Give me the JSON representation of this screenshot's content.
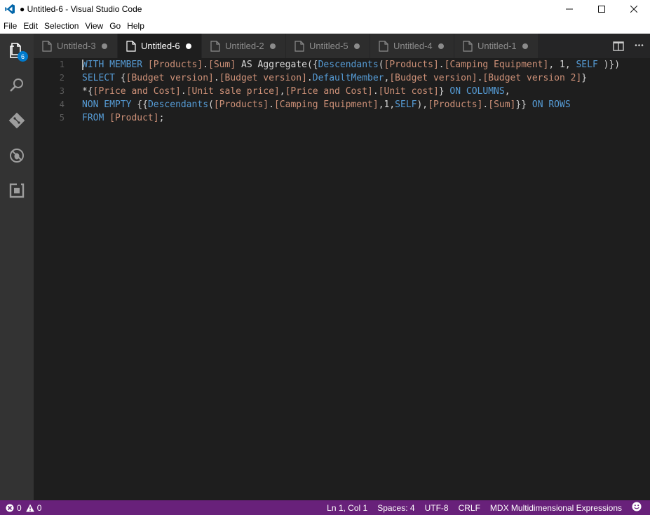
{
  "window": {
    "title": "● Untitled-6 - Visual Studio Code",
    "minimize": "—",
    "maximize": "☐",
    "close": "✕"
  },
  "menu": [
    "File",
    "Edit",
    "Selection",
    "View",
    "Go",
    "Help"
  ],
  "activity": {
    "explorer_badge": "6",
    "icons": [
      "files-icon",
      "search-icon",
      "git-icon",
      "debug-icon",
      "extensions-icon"
    ]
  },
  "tabs": [
    {
      "label": "Untitled-3",
      "active": false
    },
    {
      "label": "Untitled-6",
      "active": true
    },
    {
      "label": "Untitled-2",
      "active": false
    },
    {
      "label": "Untitled-5",
      "active": false
    },
    {
      "label": "Untitled-4",
      "active": false
    },
    {
      "label": "Untitled-1",
      "active": false
    }
  ],
  "tab_actions": {
    "split": "split-editor-icon",
    "more": "•••"
  },
  "editor": {
    "lines": [
      {
        "num": "1",
        "tokens": [
          [
            "kw",
            "WITH MEMBER "
          ],
          [
            "id",
            "[Products]"
          ],
          [
            "pl",
            "."
          ],
          [
            "id",
            "[Sum]"
          ],
          [
            "pl",
            " AS "
          ],
          [
            "fn",
            "Aggregate"
          ],
          [
            "pl",
            "({"
          ],
          [
            "kw",
            "Descendants"
          ],
          [
            "pl",
            "("
          ],
          [
            "id",
            "[Products]"
          ],
          [
            "pl",
            "."
          ],
          [
            "id",
            "[Camping Equipment]"
          ],
          [
            "pl",
            ", 1, "
          ],
          [
            "kw",
            "SELF"
          ],
          [
            "pl",
            " )})"
          ]
        ]
      },
      {
        "num": "2",
        "tokens": [
          [
            "kw",
            "SELECT "
          ],
          [
            "pl",
            "{"
          ],
          [
            "id",
            "[Budget version]"
          ],
          [
            "pl",
            "."
          ],
          [
            "id",
            "[Budget version]"
          ],
          [
            "pl",
            "."
          ],
          [
            "kw",
            "DefaultMember"
          ],
          [
            "pl",
            ","
          ],
          [
            "id",
            "[Budget version]"
          ],
          [
            "pl",
            "."
          ],
          [
            "id",
            "[Budget version 2]"
          ],
          [
            "pl",
            "}"
          ]
        ]
      },
      {
        "num": "3",
        "tokens": [
          [
            "pl",
            "*{"
          ],
          [
            "id",
            "[Price and Cost]"
          ],
          [
            "pl",
            "."
          ],
          [
            "id",
            "[Unit sale price]"
          ],
          [
            "pl",
            ","
          ],
          [
            "id",
            "[Price and Cost]"
          ],
          [
            "pl",
            "."
          ],
          [
            "id",
            "[Unit cost]"
          ],
          [
            "pl",
            "} "
          ],
          [
            "kw",
            "ON COLUMNS"
          ],
          [
            "pl",
            ","
          ]
        ]
      },
      {
        "num": "4",
        "tokens": [
          [
            "kw",
            "NON EMPTY "
          ],
          [
            "pl",
            "{{"
          ],
          [
            "kw",
            "Descendants"
          ],
          [
            "pl",
            "("
          ],
          [
            "id",
            "[Products]"
          ],
          [
            "pl",
            "."
          ],
          [
            "id",
            "[Camping Equipment]"
          ],
          [
            "pl",
            ",1,"
          ],
          [
            "kw",
            "SELF"
          ],
          [
            "pl",
            "),"
          ],
          [
            "id",
            "[Products]"
          ],
          [
            "pl",
            "."
          ],
          [
            "id",
            "[Sum]"
          ],
          [
            "pl",
            "}} "
          ],
          [
            "kw",
            "ON ROWS"
          ]
        ]
      },
      {
        "num": "5",
        "tokens": [
          [
            "kw",
            "FROM "
          ],
          [
            "id",
            "[Product]"
          ],
          [
            "pl",
            ";"
          ]
        ]
      }
    ]
  },
  "status": {
    "errors": "0",
    "warnings": "0",
    "position": "Ln 1, Col 1",
    "indent": "Spaces: 4",
    "encoding": "UTF-8",
    "eol": "CRLF",
    "language": "MDX Multidimensional Expressions"
  },
  "colors": {
    "statusbar": "#68217a",
    "keyword": "#569cd6",
    "identifier": "#ce9178",
    "accent": "#007acc"
  }
}
